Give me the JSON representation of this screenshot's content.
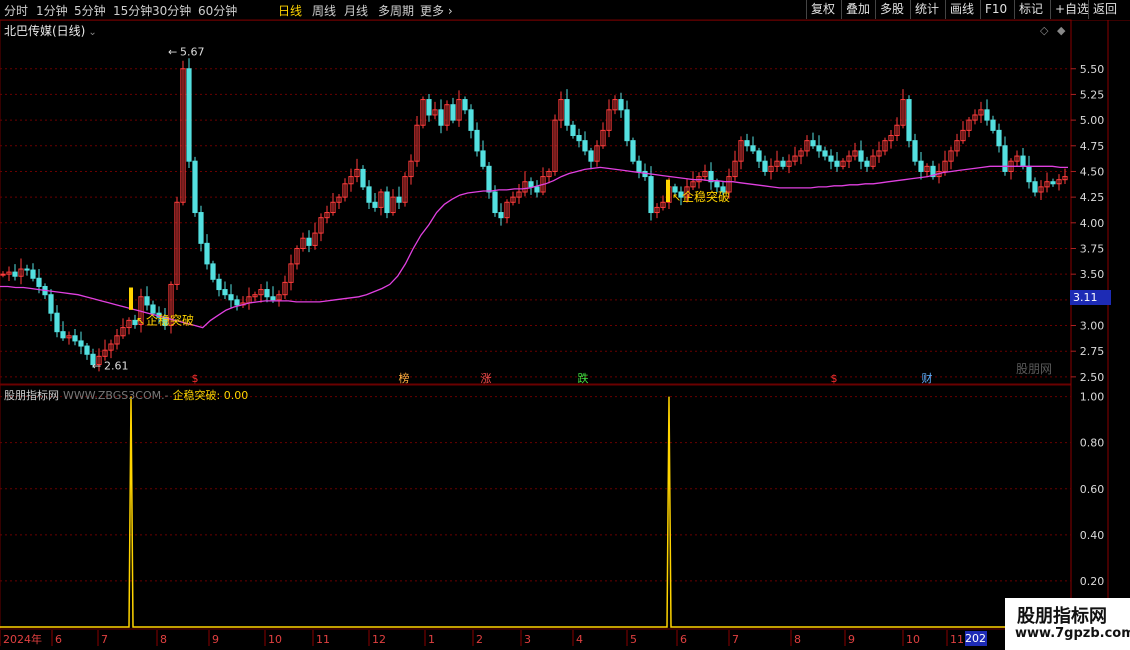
{
  "toolbar": {
    "periods": [
      "分时",
      "1分钟",
      "5分钟",
      "15分钟",
      "30分钟",
      "60分钟",
      "日线",
      "周线",
      "月线",
      "多周期",
      "更多"
    ],
    "active_period": "日线",
    "right_buttons": [
      "复权",
      "叠加",
      "多股",
      "统计",
      "画线",
      "F10",
      "标记",
      "+自选",
      "返回"
    ]
  },
  "chart_title": "北巴传媒(日线)",
  "indicator_title": {
    "name": "股朋指标网",
    "url": "WWW.ZBGS3COM.-",
    "value_label": "企稳突破: 0.00"
  },
  "current_price_tag": "3.11",
  "watermark": "股朋网",
  "brand": {
    "line1": "股朋指标网",
    "line2": "www.7gpzb.com"
  },
  "year_box": "202",
  "colors": {
    "up": "#ff3c3c",
    "down": "#54e0e0",
    "ma": "#e040e0",
    "signal": "#ffd400",
    "grid": "#6a0000"
  },
  "chart_data": [
    {
      "type": "candlestick",
      "title": "北巴传媒(日线)",
      "y_ticks": [
        "5.50",
        "5.25",
        "5.00",
        "4.75",
        "4.50",
        "4.25",
        "4.00",
        "3.75",
        "3.50",
        "3.25",
        "3.00",
        "2.75",
        "2.50"
      ],
      "ylim": [
        2.45,
        5.78
      ],
      "annotations": [
        {
          "label": "5.67",
          "value": 5.67
        },
        {
          "label": "2.61",
          "value": 2.61
        },
        {
          "label": "企稳突破",
          "value": 3.05
        },
        {
          "label": "企稳突破",
          "value": 4.25
        }
      ],
      "events": [
        "$",
        "榜",
        "涨",
        "跌",
        "$",
        "财"
      ],
      "series": [
        {
          "close": [
            3.5,
            3.52,
            3.48,
            3.55,
            3.54,
            3.46,
            3.38,
            3.3,
            3.12,
            2.94,
            2.88,
            2.9,
            2.85,
            2.8,
            2.72,
            2.62,
            2.7,
            2.76,
            2.82,
            2.9,
            2.98,
            3.05,
            3.01,
            3.28,
            3.2,
            3.12,
            3.08,
            3.0,
            3.4,
            4.2,
            5.5,
            4.6,
            4.1,
            3.8,
            3.6,
            3.45,
            3.35,
            3.3,
            3.25,
            3.2,
            3.22,
            3.28,
            3.3,
            3.35,
            3.28,
            3.25,
            3.3,
            3.42,
            3.6,
            3.75,
            3.85,
            3.78,
            3.9,
            4.05,
            4.1,
            4.2,
            4.25,
            4.38,
            4.45,
            4.52,
            4.35,
            4.2,
            4.15,
            4.3,
            4.1,
            4.25,
            4.2,
            4.45,
            4.6,
            4.95,
            5.2,
            5.05,
            5.1,
            4.95,
            5.15,
            5.0,
            5.2,
            5.1,
            4.9,
            4.7,
            4.55,
            4.3,
            4.1,
            4.05,
            4.2,
            4.25,
            4.3,
            4.4,
            4.35,
            4.3,
            4.45,
            4.5,
            5.0,
            5.2,
            4.95,
            4.85,
            4.8,
            4.7,
            4.6,
            4.75,
            4.9,
            5.1,
            5.2,
            5.1,
            4.8,
            4.6,
            4.5,
            4.45,
            4.1,
            4.15,
            4.2,
            4.35,
            4.3,
            4.25,
            4.35,
            4.4,
            4.45,
            4.5,
            4.4,
            4.35,
            4.3,
            4.45,
            4.6,
            4.8,
            4.75,
            4.7,
            4.6,
            4.5,
            4.55,
            4.6,
            4.55,
            4.6,
            4.65,
            4.7,
            4.8,
            4.75,
            4.7,
            4.65,
            4.6,
            4.55,
            4.6,
            4.65,
            4.7,
            4.6,
            4.55,
            4.65,
            4.7,
            4.8,
            4.85,
            4.95,
            5.2,
            4.8,
            4.6,
            4.5,
            4.55,
            4.45,
            4.5,
            4.6,
            4.7,
            4.8,
            4.9,
            5.0,
            5.05,
            5.1,
            5.0,
            4.9,
            4.75,
            4.5,
            4.6,
            4.65,
            4.55,
            4.4,
            4.3,
            4.35,
            4.4,
            4.38,
            4.42,
            4.45
          ],
          "ma": [
            3.38,
            3.38,
            3.37,
            3.37,
            3.36,
            3.35,
            3.34,
            3.33,
            3.32,
            3.31,
            3.3,
            3.28,
            3.26,
            3.24,
            3.22,
            3.2,
            3.18,
            3.16,
            3.14,
            3.12,
            3.1,
            3.08,
            3.06,
            3.04,
            3.02,
            3.0,
            2.98,
            3.05,
            3.1,
            3.15,
            3.18,
            3.2,
            3.22,
            3.23,
            3.24,
            3.24,
            3.24,
            3.24,
            3.23,
            3.23,
            3.23,
            3.23,
            3.24,
            3.25,
            3.26,
            3.27,
            3.28,
            3.3,
            3.33,
            3.36,
            3.4,
            3.48,
            3.6,
            3.75,
            3.88,
            3.98,
            4.1,
            4.18,
            4.23,
            4.27,
            4.29,
            4.3,
            4.31,
            4.31,
            4.32,
            4.32,
            4.33,
            4.33,
            4.34,
            4.36,
            4.38,
            4.41,
            4.45,
            4.48,
            4.5,
            4.52,
            4.53,
            4.54,
            4.53,
            4.52,
            4.51,
            4.5,
            4.49,
            4.48,
            4.47,
            4.46,
            4.45,
            4.44,
            4.43,
            4.42,
            4.42,
            4.41,
            4.41,
            4.4,
            4.4,
            4.39,
            4.38,
            4.37,
            4.36,
            4.35,
            4.34,
            4.34,
            4.34,
            4.34,
            4.34,
            4.35,
            4.35,
            4.36,
            4.36,
            4.37,
            4.37,
            4.38,
            4.38,
            4.39,
            4.4,
            4.41,
            4.42,
            4.43,
            4.44,
            4.45,
            4.47,
            4.49,
            4.5,
            4.51,
            4.52,
            4.53,
            4.54,
            4.55,
            4.55,
            4.55,
            4.55,
            4.55,
            4.55,
            4.55,
            4.55,
            4.55,
            4.54,
            4.54
          ]
        }
      ]
    },
    {
      "type": "line",
      "title": "企稳突破",
      "y_ticks": [
        "1.00",
        "0.80",
        "0.60",
        "0.40",
        "0.20"
      ],
      "ylim": [
        0,
        1.02
      ],
      "x_ticks": [
        "2024年",
        "6",
        "7",
        "8",
        "9",
        "10",
        "11",
        "12",
        "1",
        "2",
        "3",
        "4",
        "5",
        "6",
        "7",
        "8",
        "9",
        "10",
        "11"
      ],
      "signal_indices": [
        29,
        152
      ],
      "n": 250
    }
  ]
}
